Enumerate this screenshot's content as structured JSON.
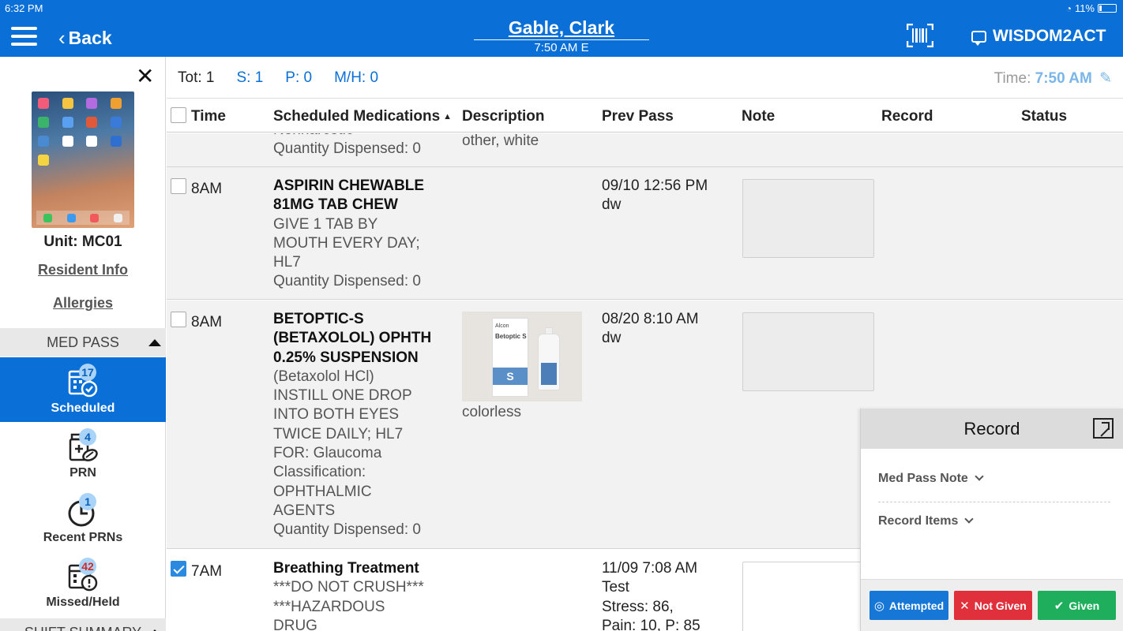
{
  "status_bar": {
    "time": "6:32 PM",
    "battery": "11%"
  },
  "header": {
    "back_label": "Back",
    "patient_name": "Gable, Clark",
    "patient_sub": "7:50 AM E",
    "org_label": "WISDOM2ACT"
  },
  "sidebar": {
    "unit": "Unit: MC01",
    "resident_info": "Resident Info",
    "allergies": "Allergies",
    "med_pass_header": "MED PASS",
    "nav": [
      {
        "label": "Scheduled",
        "badge": "17"
      },
      {
        "label": "PRN",
        "badge": "4"
      },
      {
        "label": "Recent PRNs",
        "badge": "1"
      },
      {
        "label": "Missed/Held",
        "badge": "42"
      }
    ],
    "shift_summary_header": "SHIFT SUMMARY"
  },
  "summary": {
    "tot": "Tot: 1",
    "s": "S: 1",
    "p": "P: 0",
    "mh": "M/H: 0",
    "time_label": "Time:",
    "time_value": "7:50 AM"
  },
  "columns": {
    "time": "Time",
    "meds": "Scheduled Medications",
    "description": "Description",
    "prev_pass": "Prev Pass",
    "note": "Note",
    "record": "Record",
    "status": "Status"
  },
  "rows": [
    {
      "time": "",
      "lines": [
        "Nonnarcotic",
        "Quantity Dispensed: 0"
      ],
      "description": "other, white",
      "prev_pass": []
    },
    {
      "time": "8AM",
      "name_lines": [
        "ASPIRIN CHEWABLE",
        "81MG TAB CHEW"
      ],
      "lines": [
        "GIVE 1 TAB BY",
        "MOUTH EVERY DAY;",
        "HL7",
        "Quantity Dispensed: 0"
      ],
      "description": "",
      "prev_pass": [
        "09/10 12:56 PM",
        "dw"
      ]
    },
    {
      "time": "8AM",
      "name_lines": [
        "BETOPTIC-S",
        "(BETAXOLOL) OPHTH",
        "0.25% SUSPENSION"
      ],
      "lines": [
        "(Betaxolol HCl)",
        "INSTILL ONE DROP",
        "INTO BOTH EYES",
        "TWICE DAILY; HL7",
        "FOR: Glaucoma",
        "Classification:",
        "OPHTHALMIC",
        "AGENTS",
        "Quantity Dispensed: 0"
      ],
      "description": "colorless",
      "product_brand": "Alcon",
      "product_name": "Betoptic S",
      "product_letter": "S",
      "prev_pass": [
        "08/20 8:10 AM",
        "dw"
      ]
    },
    {
      "time": "7AM",
      "name_lines": [
        "Breathing Treatment"
      ],
      "lines": [
        "***DO NOT CRUSH***",
        "***HAZARDOUS",
        "DRUG"
      ],
      "description": "",
      "prev_pass": [
        "11/09 7:08 AM",
        "Test",
        "Stress: 86,",
        "Pain: 10, P: 85"
      ]
    }
  ],
  "record_panel": {
    "title": "Record",
    "med_pass_note": "Med Pass Note",
    "record_items": "Record Items",
    "attempted": "Attempted",
    "not_given": "Not Given",
    "given": "Given"
  }
}
